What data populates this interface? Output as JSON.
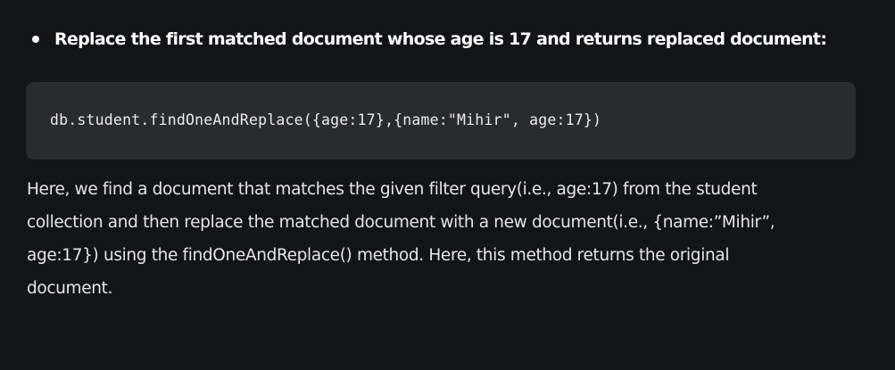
{
  "bullet": {
    "text": "Replace the first matched document whose age is 17 and returns replaced document:"
  },
  "code": {
    "text": "db.student.findOneAndReplace({age:17},{name:\"Mihir\", age:17})"
  },
  "paragraph": {
    "lines": [
      "Here, we find a document that matches the given filter query(i.e., age:17) from the student",
      "collection and then replace the matched document with a new document(i.e., {name:”Mihir”,",
      "age:17}) using the findOneAndReplace() method. Here, this method returns the original",
      "document."
    ]
  },
  "colors": {
    "page_background": "#131417",
    "code_background": "#2a2b30",
    "text": "#e6e6e8",
    "heading_text": "#ffffff"
  }
}
